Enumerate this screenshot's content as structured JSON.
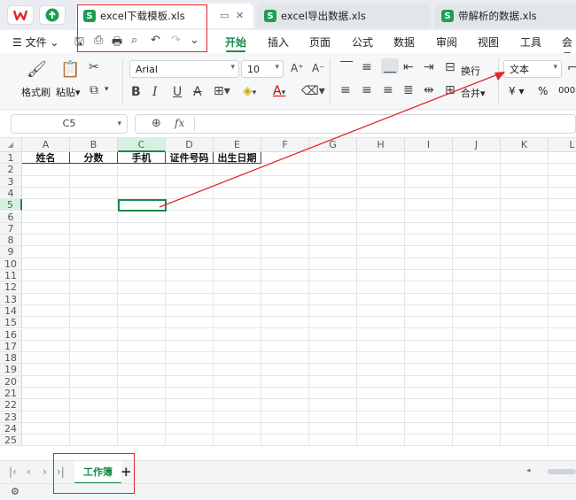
{
  "tabs": [
    {
      "label": "excel下载模板.xls",
      "active": true
    },
    {
      "label": "excel导出数据.xls",
      "active": false
    },
    {
      "label": "带解析的数据.xls",
      "active": false
    }
  ],
  "menu": {
    "file": "文件",
    "items": [
      "开始",
      "插入",
      "页面",
      "公式",
      "数据",
      "审阅",
      "视图",
      "工具",
      "会员"
    ],
    "active": "开始"
  },
  "ribbon": {
    "format_painter": "格式刷",
    "paste": "粘贴",
    "font_name": "Arial",
    "font_size": "10",
    "wrap": "换行",
    "merge": "合并",
    "number_format": "文本",
    "currency": "¥",
    "percent": "%",
    "comma": "000"
  },
  "formula_bar": {
    "name_box": "C5",
    "fx": "fx",
    "value": ""
  },
  "grid": {
    "columns": [
      "A",
      "B",
      "C",
      "D",
      "E",
      "F",
      "G",
      "H",
      "I",
      "J",
      "K",
      "L"
    ],
    "selected_col": "C",
    "selected_row": 5,
    "rows": [
      "1",
      "2",
      "3",
      "4",
      "5",
      "6",
      "7",
      "8",
      "9",
      "10",
      "11",
      "12",
      "13",
      "14",
      "15",
      "16",
      "17",
      "18",
      "19",
      "20",
      "21",
      "22",
      "23",
      "24",
      "25"
    ],
    "headers": [
      "姓名",
      "分数",
      "手机",
      "证件号码",
      "出生日期"
    ]
  },
  "sheets": [
    {
      "label": "工作簿"
    }
  ],
  "add_sheet": "+",
  "colors": {
    "accent": "#178a4a",
    "annotation": "#e0262b"
  }
}
